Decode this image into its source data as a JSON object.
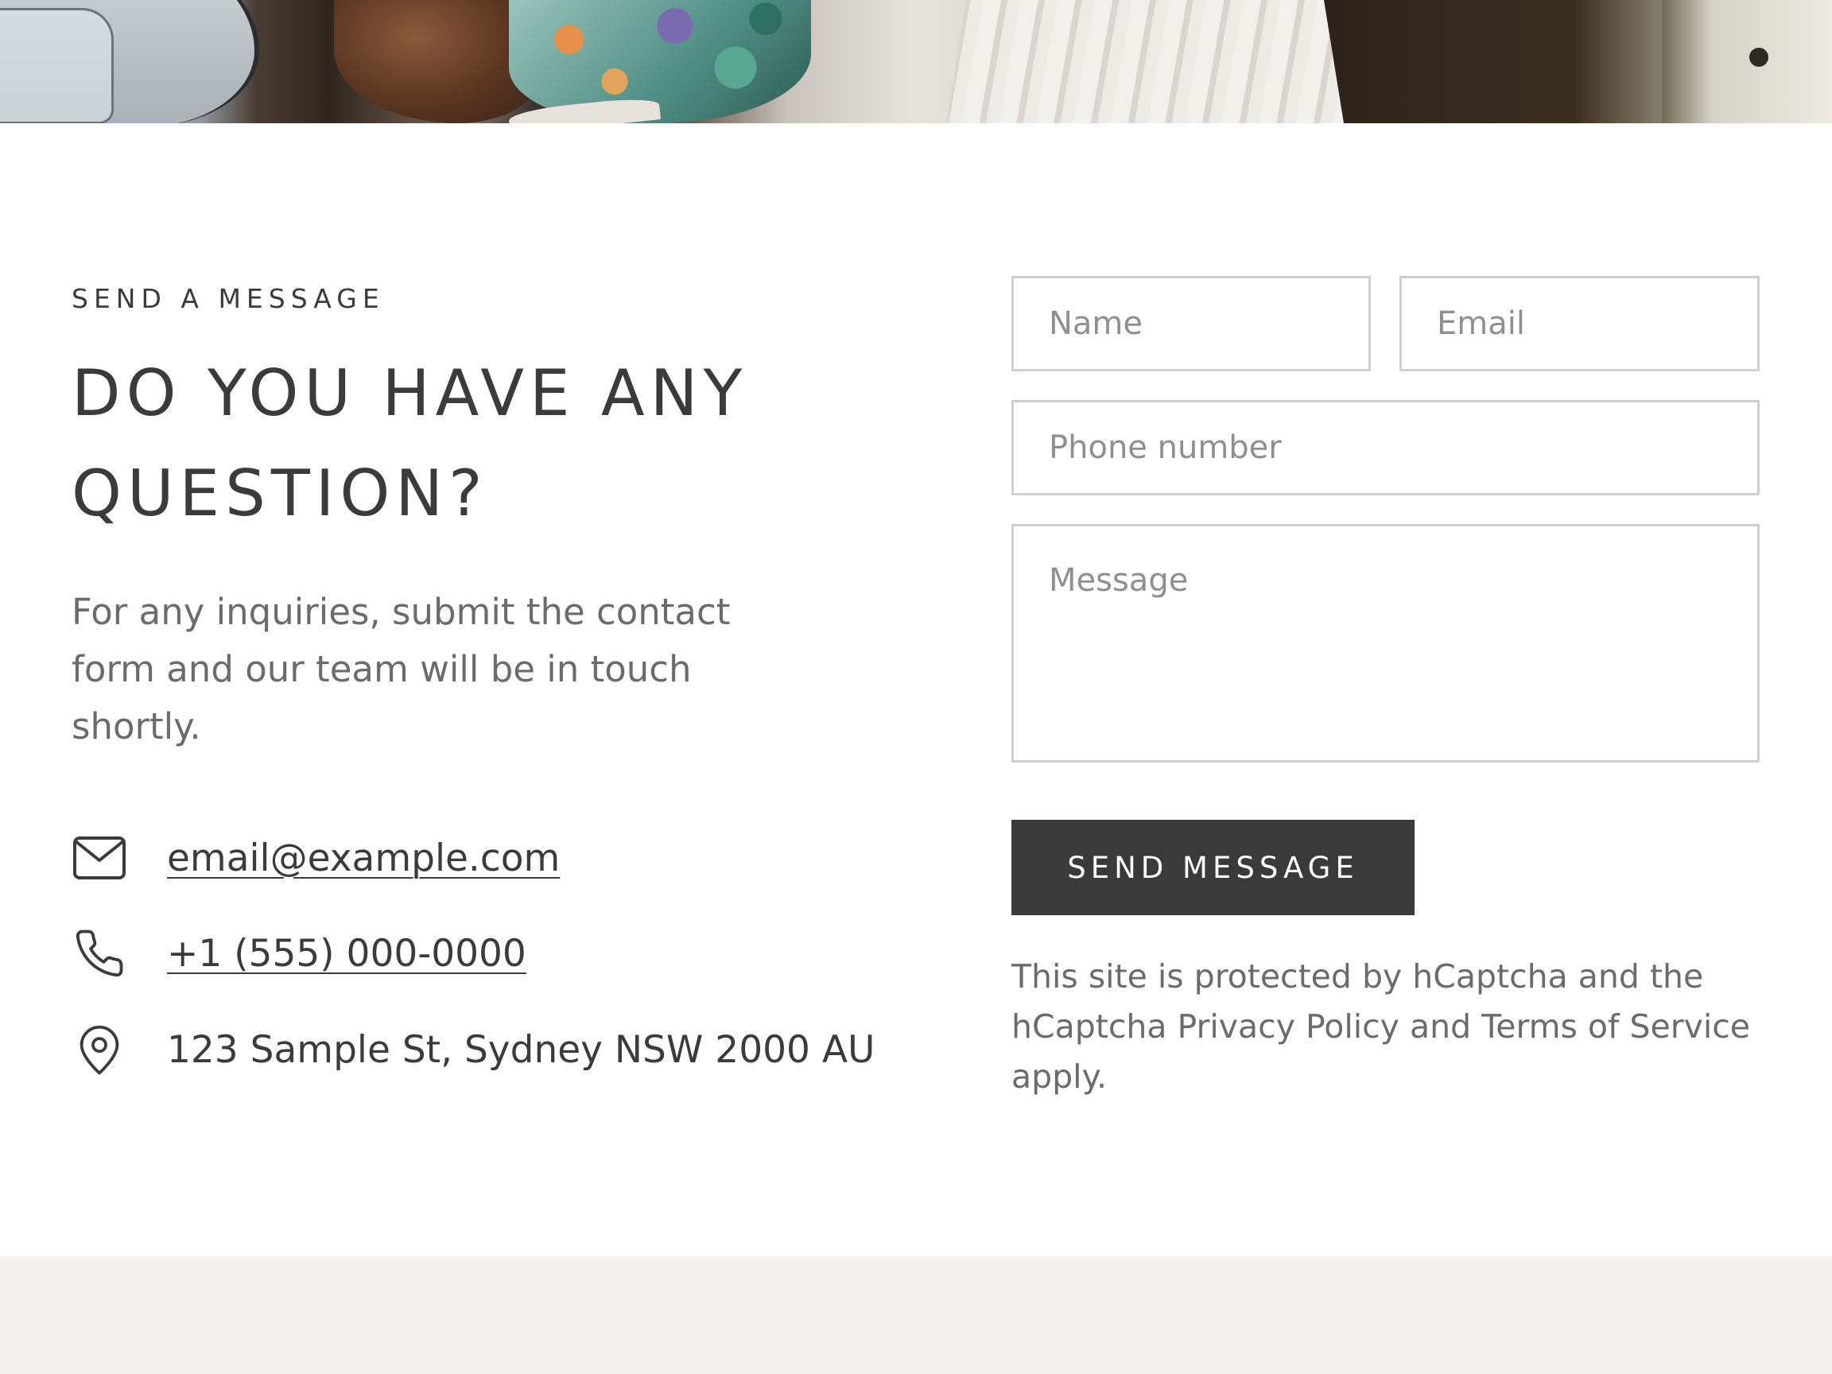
{
  "section": {
    "eyebrow": "SEND A MESSAGE",
    "headline": "DO YOU HAVE ANY QUESTION?",
    "intro": "For any inquiries, submit the contact form and our team will be in touch shortly."
  },
  "contact": {
    "email": "email@example.com",
    "phone": "+1 (555) 000-0000",
    "address": "123 Sample St, Sydney NSW 2000 AU"
  },
  "form": {
    "name_placeholder": "Name",
    "email_placeholder": "Email",
    "phone_placeholder": "Phone number",
    "message_placeholder": "Message",
    "submit_label": "SEND MESSAGE",
    "captcha_note": "This site is protected by hCaptcha and the hCaptcha Privacy Policy and Terms of Service apply."
  },
  "icons": {
    "email": "mail-icon",
    "phone": "phone-icon",
    "address": "map-pin-icon"
  },
  "colors": {
    "text": "#3b3b3b",
    "muted_text": "#6b6b6b",
    "field_border": "#cfcfcf",
    "button_bg": "#3a3a3a",
    "footer_bg": "#f4f0ed"
  }
}
